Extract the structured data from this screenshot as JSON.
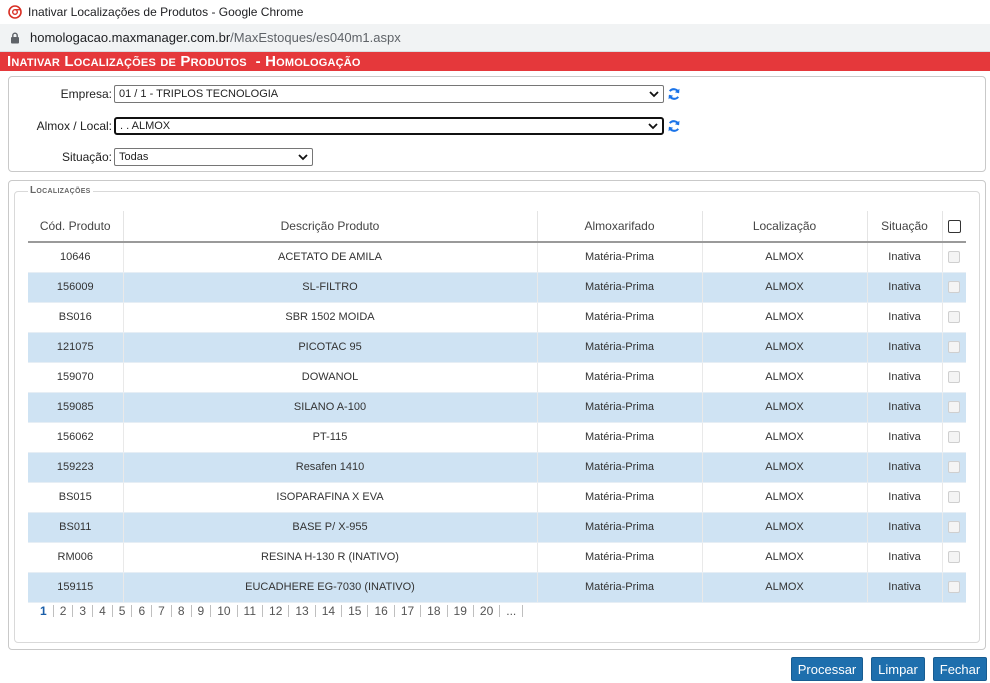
{
  "window": {
    "title": "Inativar Localizações de Produtos - Google Chrome",
    "url_host": "homologacao.maxmanager.com.br",
    "url_path": "/MaxEstoques/es040m1.aspx"
  },
  "header": {
    "title": "Inativar Localizações de Produtos  - Homologação",
    "color": "#e5383b"
  },
  "filters": {
    "empresa_label": "Empresa:",
    "empresa_value": "01 / 1 - TRIPLOS TECNOLOGIA",
    "almox_label": "Almox / Local:",
    "almox_value": ". . ALMOX",
    "situacao_label": "Situação:",
    "situacao_value": "Todas"
  },
  "localizacoes": {
    "legend": "Localizações",
    "columns": [
      "Cód. Produto",
      "Descrição Produto",
      "Almoxarifado",
      "Localização",
      "Situação"
    ],
    "rows": [
      {
        "cod": "10646",
        "desc": "ACETATO DE AMILA",
        "almox": "Matéria-Prima",
        "loc": "ALMOX",
        "sit": "Inativa"
      },
      {
        "cod": "156009",
        "desc": "SL-FILTRO",
        "almox": "Matéria-Prima",
        "loc": "ALMOX",
        "sit": "Inativa"
      },
      {
        "cod": "BS016",
        "desc": "SBR 1502 MOIDA",
        "almox": "Matéria-Prima",
        "loc": "ALMOX",
        "sit": "Inativa"
      },
      {
        "cod": "121075",
        "desc": "PICOTAC 95",
        "almox": "Matéria-Prima",
        "loc": "ALMOX",
        "sit": "Inativa"
      },
      {
        "cod": "159070",
        "desc": "DOWANOL",
        "almox": "Matéria-Prima",
        "loc": "ALMOX",
        "sit": "Inativa"
      },
      {
        "cod": "159085",
        "desc": "SILANO A-100",
        "almox": "Matéria-Prima",
        "loc": "ALMOX",
        "sit": "Inativa"
      },
      {
        "cod": "156062",
        "desc": "PT-115",
        "almox": "Matéria-Prima",
        "loc": "ALMOX",
        "sit": "Inativa"
      },
      {
        "cod": "159223",
        "desc": "Resafen 1410",
        "almox": "Matéria-Prima",
        "loc": "ALMOX",
        "sit": "Inativa"
      },
      {
        "cod": "BS015",
        "desc": "ISOPARAFINA X EVA",
        "almox": "Matéria-Prima",
        "loc": "ALMOX",
        "sit": "Inativa"
      },
      {
        "cod": "BS011",
        "desc": "BASE P/ X-955",
        "almox": "Matéria-Prima",
        "loc": "ALMOX",
        "sit": "Inativa"
      },
      {
        "cod": "RM006",
        "desc": "RESINA H-130 R (INATIVO)",
        "almox": "Matéria-Prima",
        "loc": "ALMOX",
        "sit": "Inativa"
      },
      {
        "cod": "159115",
        "desc": "EUCADHERE EG-7030 (INATIVO)",
        "almox": "Matéria-Prima",
        "loc": "ALMOX",
        "sit": "Inativa"
      }
    ],
    "pages": [
      "1",
      "2",
      "3",
      "4",
      "5",
      "6",
      "7",
      "8",
      "9",
      "10",
      "11",
      "12",
      "13",
      "14",
      "15",
      "16",
      "17",
      "18",
      "19",
      "20",
      "..."
    ],
    "current_page": "1"
  },
  "buttons": {
    "processar": "Processar",
    "limpar": "Limpar",
    "fechar": "Fechar"
  },
  "colors": {
    "row_alt": "#cfe3f3",
    "button": "#1e6fad",
    "refresh": "#1a73e8"
  },
  "icons": {
    "browser": "chrome-logo-icon",
    "lock": "lock-icon",
    "refresh": "refresh-icon",
    "dropdown": "chevron-down-icon"
  }
}
